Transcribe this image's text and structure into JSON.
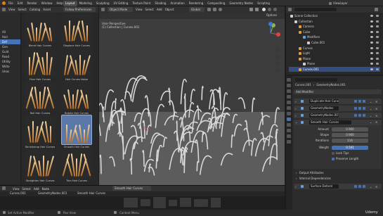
{
  "menu": {
    "items": [
      "File",
      "Edit",
      "Render",
      "Window",
      "Help"
    ],
    "workspaces": [
      "Layout",
      "Modeling",
      "Sculpting",
      "UV Editing",
      "Texture Paint",
      "Shading",
      "Animation",
      "Rendering",
      "Compositing",
      "Geometry Nodes",
      "Scripting"
    ],
    "active_workspace": "Layout",
    "view_layer": "ViewLayer"
  },
  "asset_browser": {
    "header_items": [
      "View",
      "Select",
      "Catalog",
      "Asset"
    ],
    "library": "Follow Preferences",
    "side_items": [
      "All",
      "Hair",
      "Def",
      "Gen",
      "Guid",
      "Read",
      "Utility",
      "Write",
      "Unas"
    ],
    "selected_side": "Def",
    "tiles": [
      {
        "label": "Blend Hair Curves"
      },
      {
        "label": "Displace Hair Curves"
      },
      {
        "label": "Frizz Hair Curves"
      },
      {
        "label": "Hair Curves Noise"
      },
      {
        "label": "Roll Hair Curves"
      },
      {
        "label": "Rotate Hair Curves"
      },
      {
        "label": "Shrinkwrap Hair Curves"
      },
      {
        "label": "Smooth Hair Curves"
      },
      {
        "label": "Straighten Hair Curves"
      },
      {
        "label": "Trim Hair Curves"
      }
    ],
    "selected_tile": "Smooth Hair Curves"
  },
  "viewport": {
    "mode": "Object Mode",
    "menus": [
      "View",
      "Select",
      "Add",
      "Object"
    ],
    "transform": "Global",
    "perspective": "User Perspective",
    "collection_path": "(1) Collection | Curves.001",
    "options_label": "Options"
  },
  "node_editor": {
    "menus": [
      "View",
      "Select",
      "Add",
      "Node"
    ],
    "node_group": "Smooth Hair Curves",
    "breadcrumb": [
      "Curves.001",
      "GeometryNodes.001",
      "Smooth Hair Curves"
    ]
  },
  "outliner": {
    "items": [
      {
        "label": "Scene Collection",
        "color": "#cfcfcf"
      },
      {
        "label": "Collection",
        "color": "#cfcfcf"
      },
      {
        "label": "Camera",
        "color": "#e39b3b"
      },
      {
        "label": "Cube",
        "color": "#e39b3b"
      },
      {
        "label": "Modifiers",
        "color": "#6aa0e0"
      },
      {
        "label": "Cube.001",
        "color": "#cfcfcf"
      },
      {
        "label": "Curves",
        "color": "#e39b3b"
      },
      {
        "label": "Light",
        "color": "#e39b3b"
      },
      {
        "label": "Plane",
        "color": "#e39b3b"
      },
      {
        "label": "Plane",
        "color": "#cfcfcf"
      },
      {
        "label": "Curves.001",
        "color": "#e39b3b"
      }
    ],
    "selected": "Curves.001"
  },
  "properties": {
    "breadcrumb": [
      "Curves.001",
      "GeometryNodes.001"
    ],
    "add_modifier": "Add Modifier",
    "modifiers": [
      "Duplicate Hair Curves",
      "GeometryNodes",
      "GeometryNodes.001"
    ],
    "active_modifier": "Smooth Hair Curves",
    "params": [
      {
        "label": "Amount",
        "value": "0.900"
      },
      {
        "label": "Shape",
        "value": "0.900"
      },
      {
        "label": "Iterations",
        "value": "114"
      },
      {
        "label": "Weight",
        "value": "0.541"
      }
    ],
    "lock_tips": "Lock Tips",
    "preserve_length": "Preserve Length",
    "sections": [
      "Output Attributes",
      "Internal Dependencies"
    ],
    "last_modifier": "Surface Deform"
  },
  "status_bar": {
    "items": [
      "Set Active Modifier",
      "Pan View",
      "Context Menu"
    ],
    "watermark": "Udemy"
  },
  "colors": {
    "accent": "#4772b3",
    "selection": "#334d80",
    "hair_light": "#f4d7a8",
    "hair_dark": "#b36a22"
  }
}
